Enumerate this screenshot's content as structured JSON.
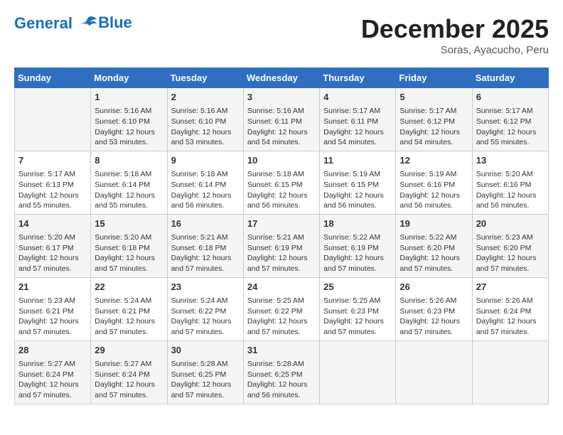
{
  "logo": {
    "line1": "General",
    "line2": "Blue"
  },
  "title": "December 2025",
  "subtitle": "Soras, Ayacucho, Peru",
  "days_of_week": [
    "Sunday",
    "Monday",
    "Tuesday",
    "Wednesday",
    "Thursday",
    "Friday",
    "Saturday"
  ],
  "weeks": [
    [
      {
        "day": "",
        "info": ""
      },
      {
        "day": "1",
        "info": "Sunrise: 5:16 AM\nSunset: 6:10 PM\nDaylight: 12 hours\nand 53 minutes."
      },
      {
        "day": "2",
        "info": "Sunrise: 5:16 AM\nSunset: 6:10 PM\nDaylight: 12 hours\nand 53 minutes."
      },
      {
        "day": "3",
        "info": "Sunrise: 5:16 AM\nSunset: 6:11 PM\nDaylight: 12 hours\nand 54 minutes."
      },
      {
        "day": "4",
        "info": "Sunrise: 5:17 AM\nSunset: 6:11 PM\nDaylight: 12 hours\nand 54 minutes."
      },
      {
        "day": "5",
        "info": "Sunrise: 5:17 AM\nSunset: 6:12 PM\nDaylight: 12 hours\nand 54 minutes."
      },
      {
        "day": "6",
        "info": "Sunrise: 5:17 AM\nSunset: 6:12 PM\nDaylight: 12 hours\nand 55 minutes."
      }
    ],
    [
      {
        "day": "7",
        "info": "Sunrise: 5:17 AM\nSunset: 6:13 PM\nDaylight: 12 hours\nand 55 minutes."
      },
      {
        "day": "8",
        "info": "Sunrise: 5:18 AM\nSunset: 6:14 PM\nDaylight: 12 hours\nand 55 minutes."
      },
      {
        "day": "9",
        "info": "Sunrise: 5:18 AM\nSunset: 6:14 PM\nDaylight: 12 hours\nand 56 minutes."
      },
      {
        "day": "10",
        "info": "Sunrise: 5:18 AM\nSunset: 6:15 PM\nDaylight: 12 hours\nand 56 minutes."
      },
      {
        "day": "11",
        "info": "Sunrise: 5:19 AM\nSunset: 6:15 PM\nDaylight: 12 hours\nand 56 minutes."
      },
      {
        "day": "12",
        "info": "Sunrise: 5:19 AM\nSunset: 6:16 PM\nDaylight: 12 hours\nand 56 minutes."
      },
      {
        "day": "13",
        "info": "Sunrise: 5:20 AM\nSunset: 6:16 PM\nDaylight: 12 hours\nand 56 minutes."
      }
    ],
    [
      {
        "day": "14",
        "info": "Sunrise: 5:20 AM\nSunset: 6:17 PM\nDaylight: 12 hours\nand 57 minutes."
      },
      {
        "day": "15",
        "info": "Sunrise: 5:20 AM\nSunset: 6:18 PM\nDaylight: 12 hours\nand 57 minutes."
      },
      {
        "day": "16",
        "info": "Sunrise: 5:21 AM\nSunset: 6:18 PM\nDaylight: 12 hours\nand 57 minutes."
      },
      {
        "day": "17",
        "info": "Sunrise: 5:21 AM\nSunset: 6:19 PM\nDaylight: 12 hours\nand 57 minutes."
      },
      {
        "day": "18",
        "info": "Sunrise: 5:22 AM\nSunset: 6:19 PM\nDaylight: 12 hours\nand 57 minutes."
      },
      {
        "day": "19",
        "info": "Sunrise: 5:22 AM\nSunset: 6:20 PM\nDaylight: 12 hours\nand 57 minutes."
      },
      {
        "day": "20",
        "info": "Sunrise: 5:23 AM\nSunset: 6:20 PM\nDaylight: 12 hours\nand 57 minutes."
      }
    ],
    [
      {
        "day": "21",
        "info": "Sunrise: 5:23 AM\nSunset: 6:21 PM\nDaylight: 12 hours\nand 57 minutes."
      },
      {
        "day": "22",
        "info": "Sunrise: 5:24 AM\nSunset: 6:21 PM\nDaylight: 12 hours\nand 57 minutes."
      },
      {
        "day": "23",
        "info": "Sunrise: 5:24 AM\nSunset: 6:22 PM\nDaylight: 12 hours\nand 57 minutes."
      },
      {
        "day": "24",
        "info": "Sunrise: 5:25 AM\nSunset: 6:22 PM\nDaylight: 12 hours\nand 57 minutes."
      },
      {
        "day": "25",
        "info": "Sunrise: 5:25 AM\nSunset: 6:23 PM\nDaylight: 12 hours\nand 57 minutes."
      },
      {
        "day": "26",
        "info": "Sunrise: 5:26 AM\nSunset: 6:23 PM\nDaylight: 12 hours\nand 57 minutes."
      },
      {
        "day": "27",
        "info": "Sunrise: 5:26 AM\nSunset: 6:24 PM\nDaylight: 12 hours\nand 57 minutes."
      }
    ],
    [
      {
        "day": "28",
        "info": "Sunrise: 5:27 AM\nSunset: 6:24 PM\nDaylight: 12 hours\nand 57 minutes."
      },
      {
        "day": "29",
        "info": "Sunrise: 5:27 AM\nSunset: 6:24 PM\nDaylight: 12 hours\nand 57 minutes."
      },
      {
        "day": "30",
        "info": "Sunrise: 5:28 AM\nSunset: 6:25 PM\nDaylight: 12 hours\nand 57 minutes."
      },
      {
        "day": "31",
        "info": "Sunrise: 5:28 AM\nSunset: 6:25 PM\nDaylight: 12 hours\nand 56 minutes."
      },
      {
        "day": "",
        "info": ""
      },
      {
        "day": "",
        "info": ""
      },
      {
        "day": "",
        "info": ""
      }
    ]
  ]
}
